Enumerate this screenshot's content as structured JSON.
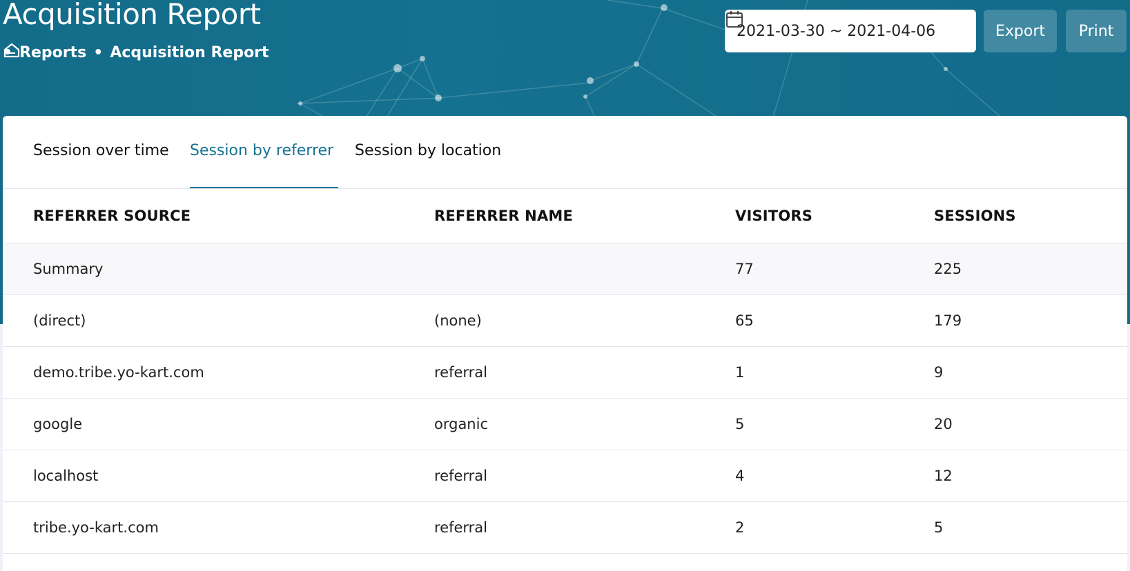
{
  "header": {
    "title": "Acquisition Report",
    "breadcrumb": [
      {
        "icon": "home-icon"
      },
      {
        "label": "Reports"
      },
      {
        "label": "Acquisition Report"
      }
    ],
    "separator": "•",
    "date_range": "2021-03-30 ~ 2021-04-06",
    "export_label": "Export",
    "print_label": "Print"
  },
  "tabs": [
    {
      "label": "Session over time",
      "active": false
    },
    {
      "label": "Session by referrer",
      "active": true
    },
    {
      "label": "Session by location",
      "active": false
    }
  ],
  "table": {
    "columns": [
      "REFERRER SOURCE",
      "REFERRER NAME",
      "VISITORS",
      "SESSIONS"
    ],
    "summary": {
      "source": "Summary",
      "name": "",
      "visitors": "77",
      "sessions": "225"
    },
    "rows": [
      {
        "source": "(direct)",
        "name": "(none)",
        "visitors": "65",
        "sessions": "179"
      },
      {
        "source": "demo.tribe.yo-kart.com",
        "name": "referral",
        "visitors": "1",
        "sessions": "9"
      },
      {
        "source": "google",
        "name": "organic",
        "visitors": "5",
        "sessions": "20"
      },
      {
        "source": "localhost",
        "name": "referral",
        "visitors": "4",
        "sessions": "12"
      },
      {
        "source": "tribe.yo-kart.com",
        "name": "referral",
        "visitors": "2",
        "sessions": "5"
      }
    ]
  },
  "colors": {
    "header_bg": "#136c8a",
    "accent": "#167393"
  }
}
